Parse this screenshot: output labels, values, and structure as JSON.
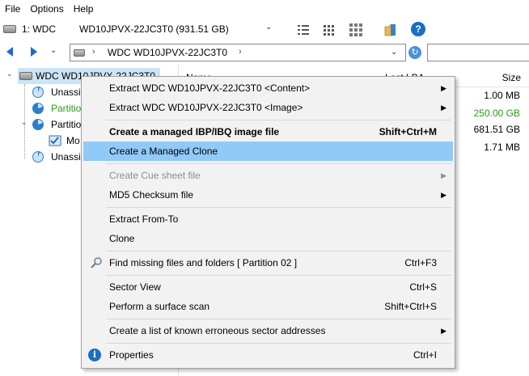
{
  "menubar": {
    "items": [
      "File",
      "Options",
      "Help"
    ]
  },
  "drive_toolbar": {
    "drive_label": "1: WDC",
    "drive_model": "WD10JPVX-22JC3T0   (931.51 GB)"
  },
  "navbar": {
    "path": "WDC WD10JPVX-22JC3T0"
  },
  "tree": {
    "items": [
      {
        "label": "WDC WD10JPVX-22JC3T0"
      },
      {
        "label": "Unassi"
      },
      {
        "label": "Partitio"
      },
      {
        "label": "Partitio"
      },
      {
        "label": "Mo"
      },
      {
        "label": "Unassi"
      }
    ]
  },
  "list": {
    "headers": {
      "name": "Name",
      "lba": "Last LBA",
      "size": "Size"
    },
    "sizes": [
      "1.00 MB",
      "250.00 GB",
      "681.51 GB",
      "1.71 MB"
    ]
  },
  "context_menu": {
    "items": [
      {
        "label": "Extract WDC WD10JPVX-22JC3T0  <Content>",
        "submenu": "›"
      },
      {
        "label": "Extract WDC WD10JPVX-22JC3T0  <Image>",
        "submenu": "›"
      },
      {
        "label": "Create a managed IBP/IBQ image file",
        "shortcut": "Shift+Ctrl+M"
      },
      {
        "label": "Create a Managed Clone"
      },
      {
        "label": "Create Cue sheet file",
        "submenu": "›"
      },
      {
        "label": "MD5 Checksum file",
        "submenu": "›"
      },
      {
        "label": "Extract From-To"
      },
      {
        "label": "Clone"
      },
      {
        "label": "Find missing files and folders [ Partition 02 ]",
        "shortcut": "Ctrl+F3"
      },
      {
        "label": "Sector View",
        "shortcut": "Ctrl+S"
      },
      {
        "label": "Perform a surface scan",
        "shortcut": "Shift+Ctrl+S"
      },
      {
        "label": "Create a list of known erroneous sector addresses",
        "submenu": "›"
      },
      {
        "label": "Properties",
        "shortcut": "Ctrl+I"
      }
    ]
  },
  "colors": {
    "menu_highlight": "#91c9f7",
    "tree_selection": "#cce4f7",
    "partition_green": "#2c9a1a",
    "accent_blue": "#1a6fc2"
  }
}
